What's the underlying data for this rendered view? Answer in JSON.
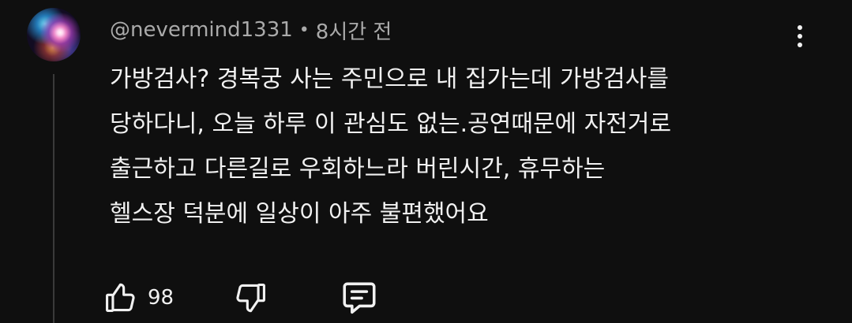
{
  "comment": {
    "author": "@nevermind1331",
    "separator": "•",
    "time": "8시간 전",
    "lines": [
      "가방검사? 경복궁 사는 주민으로 내 집가는데 가방검사를",
      "당하다니, 오늘 하루 이 관심도 없는.공연때문에 자전거로",
      "출근하고 다른길로 우회하느라 버린시간, 휴무하는",
      "헬스장 덕분에 일상이 아주 불편했어요"
    ],
    "like_count": "98"
  },
  "icons": {
    "menu": "more-vertical-icon",
    "like": "thumbs-up-icon",
    "dislike": "thumbs-down-icon",
    "reply": "comment-reply-icon"
  },
  "colors": {
    "background": "#0f0f0f",
    "text": "#f1f1f1",
    "secondary_text": "#aaaaaa",
    "thread_line": "#3a3a3a"
  }
}
